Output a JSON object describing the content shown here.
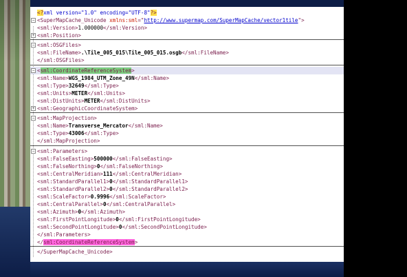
{
  "xml": {
    "decl_open": "<?",
    "decl_text": "xml version=\"1.0\" encoding=\"UTF-8\"",
    "decl_close": "?>",
    "root_open_tag": "<SuperMapCache_Unicode",
    "root_attr_name": "xmlns:sml",
    "root_attr_eq": "=\"",
    "root_attr_value": "http://www.supermap.com/SuperMapCache/vector1tile",
    "root_attr_end": "\">",
    "version_open": "<sml:Version>",
    "version_value": "1.000000",
    "version_close": "</sml:Version>",
    "position": "<sml:Position>",
    "osgfiles_open": "<sml:OSGFiles>",
    "filename_open": "<sml:FileName>",
    "filename_value": ".\\Tile_005_015\\Tile_005_015.osgb",
    "filename_close": "</sml:FileName>",
    "osgfiles_close": "</sml:OSGFiles>",
    "crs_open_bracket": "<",
    "crs_open_name": "sml:CoordinateReferenceSystem",
    "crs_open_end": ">",
    "name_open": "<sml:Name>",
    "name_value": "WGS_1984_UTM_Zone_49N",
    "name_close": "</sml:Name>",
    "type_open": "<sml:Type>",
    "type_value": "32649",
    "type_close": "</sml:Type>",
    "units_open": "<sml:Units>",
    "units_value": "METER",
    "units_close": "</sml:Units>",
    "distunits_open": "<sml:DistUnits>",
    "distunits_value": "METER",
    "distunits_close": "</sml:DistUnits>",
    "geocs": "<sml:GeographicCoordinateSystem>",
    "mapproj_open": "<sml:MapProjection>",
    "mp_name_value": "Transverse_Mercator",
    "mp_type_value": "43006",
    "mapproj_close": "</sml:MapProjection>",
    "params_open": "<sml:Parameters>",
    "fe_open": "<sml:FalseEasting>",
    "fe_value": "500000",
    "fe_close": "</sml:FalseEasting>",
    "fn_open": "<sml:FalseNorthing>",
    "fn_value": "0",
    "fn_close": "</sml:FalseNorthing>",
    "cm_open": "<sml:CentralMeridian>",
    "cm_value": "111",
    "cm_close": "</sml:CentralMeridian>",
    "sp1_open": "<sml:StandardParallel1>",
    "sp1_value": "0",
    "sp1_close": "</sml:StandardParallel1>",
    "sp2_open": "<sml:StandardParallel2>",
    "sp2_value": "0",
    "sp2_close": "</sml:StandardParallel2>",
    "sf_open": "<sml:ScaleFactor>",
    "sf_value": "0.9996",
    "sf_close": "</sml:ScaleFactor>",
    "cp_open": "<sml:CentralParallel>",
    "cp_value": "0",
    "cp_close": "</sml:CentralParallel>",
    "az_open": "<sml:Azimuth>",
    "az_value": "0",
    "az_close": "</sml:Azimuth>",
    "fpl_open": "<sml:FirstPointLongitude>",
    "fpl_value": "0",
    "fpl_close": "</sml:FirstPointLongitude>",
    "spl_open": "<sml:SecondPointLongitude>",
    "spl_value": "0",
    "spl_close": "</sml:SecondPointLongitude>",
    "params_close": "</sml:Parameters>",
    "crs_close_bracket": "</",
    "crs_close_name": "sml:CoordinateReferenceSystem",
    "crs_close_end": ">",
    "root_close": "</SuperMapCache_Unicode>"
  },
  "colors": {
    "tag": "#7a1d4c",
    "value": "#000000",
    "attribute": "#cc1a00",
    "attribute_value": "#0000cc",
    "highlight_green": "#7bd07e",
    "highlight_pink": "#ff66dd",
    "highlight_yellow": "#ffe14a",
    "selected_row": "#e3e4f4"
  }
}
